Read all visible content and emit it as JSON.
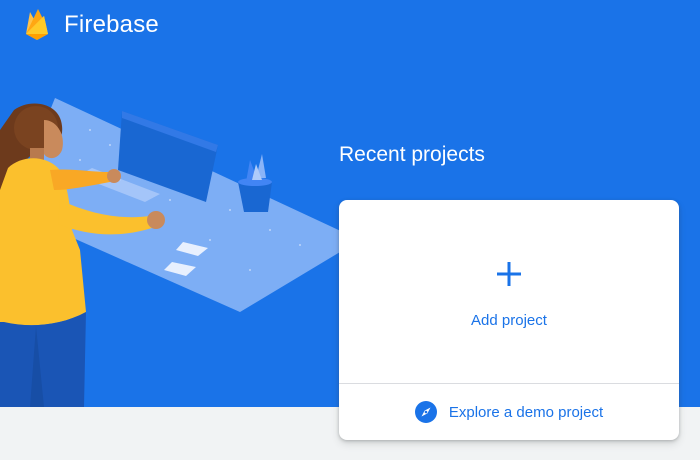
{
  "header": {
    "brand": "Firebase",
    "logo_icon": "firebase-flame-icon"
  },
  "colors": {
    "hero_blue": "#1a73e8",
    "page_bg": "#f1f3f4",
    "link_blue": "#1a73e8",
    "flame_yellow": "#ffca28",
    "flame_orange": "#ffa000"
  },
  "main": {
    "section_title": "Recent projects",
    "add_project": {
      "label": "Add project",
      "icon": "plus-icon"
    },
    "demo": {
      "label": "Explore a demo project",
      "icon": "compass-icon"
    }
  }
}
